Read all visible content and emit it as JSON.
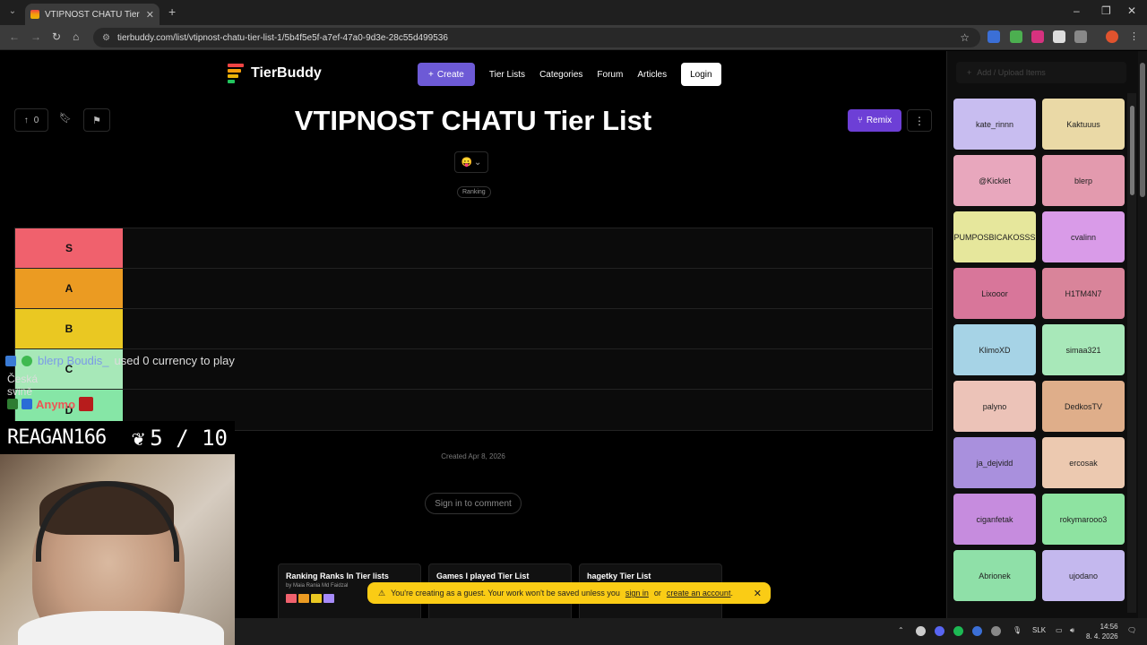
{
  "browser": {
    "tab_title": "VTIPNOST CHATU Tier List | Tie",
    "url": "tierbuddy.com/list/vtipnost-chatu-tier-list-1/5b4f5e5f-a7ef-47a0-9d3e-28c55d499536",
    "new_tab": "+",
    "tab_close": "✕"
  },
  "site": {
    "logo_text": "TierBuddy",
    "nav": {
      "create": "Create",
      "tier_lists": "Tier Lists",
      "categories": "Categories",
      "forum": "Forum",
      "articles": "Articles",
      "login": "Login"
    }
  },
  "list": {
    "vote_count": "0",
    "title": "VTIPNOST CHATU Tier List",
    "remix_label": "Remix",
    "reaction_emoji": "😛",
    "tag": "Ranking",
    "created": "Created Apr 8, 2026",
    "sign_in_comment": "Sign in to comment"
  },
  "tiers": [
    {
      "label": "S",
      "color": "#f0616d"
    },
    {
      "label": "A",
      "color": "#eb9b22"
    },
    {
      "label": "B",
      "color": "#eac822"
    },
    {
      "label": "C",
      "color": "#a7e8b8"
    },
    {
      "label": "D",
      "color": "#86e6a6"
    }
  ],
  "related_cards": [
    {
      "title": "Ranking Ranks In Tier lists",
      "by": "by Maia Rania Md Faidzal"
    },
    {
      "title": "Games I played Tier List",
      "by": ""
    },
    {
      "title": "hagetky Tier List",
      "by": ""
    }
  ],
  "toast": {
    "prefix": "You're creating as a guest. Your work won't be saved unless you",
    "sign_in": "sign in",
    "or": "or",
    "create_account": "create an account",
    "suffix": ".",
    "close": "✕"
  },
  "sidebar": {
    "upload_placeholder": "Add / Upload Items",
    "items": [
      {
        "name": "kate_rinnn",
        "color": "#c8bdf0"
      },
      {
        "name": "Kaktuuus",
        "color": "#ead9a6"
      },
      {
        "name": "@Kicklet",
        "color": "#e8a7bd"
      },
      {
        "name": "blerp",
        "color": "#e39aae"
      },
      {
        "name": "PUMPOSBICAKOSSS",
        "color": "#e6e79c"
      },
      {
        "name": "cvalinn",
        "color": "#d99be8"
      },
      {
        "name": "Lixooor",
        "color": "#d8769a"
      },
      {
        "name": "H1TM4N7",
        "color": "#d9849a"
      },
      {
        "name": "KlimoXD",
        "color": "#a6d3e6"
      },
      {
        "name": "simaa321",
        "color": "#a8e8b9"
      },
      {
        "name": "palyno",
        "color": "#ecc3b8"
      },
      {
        "name": "DedkosTV",
        "color": "#dfae8a"
      },
      {
        "name": "ja_dejvidd",
        "color": "#a990dd"
      },
      {
        "name": "ercosak",
        "color": "#ecc9b0"
      },
      {
        "name": "ciganfetak",
        "color": "#c68cde"
      },
      {
        "name": "rokymarooo3",
        "color": "#8ee3a1"
      },
      {
        "name": "Abrionek",
        "color": "#8fe0a8"
      },
      {
        "name": "ujodano",
        "color": "#c4b8ee"
      }
    ]
  },
  "stream_overlay": {
    "chat_user": "blerp Boudis_",
    "chat_message": "used 0 currency to play",
    "chat_line2": "Česká svině",
    "chat_user2": "Anymo",
    "streamer": "REAGAN166",
    "score": "5 / 10"
  },
  "taskbar": {
    "lang": "SLK",
    "time": "14:56",
    "date": "8. 4. 2026"
  }
}
